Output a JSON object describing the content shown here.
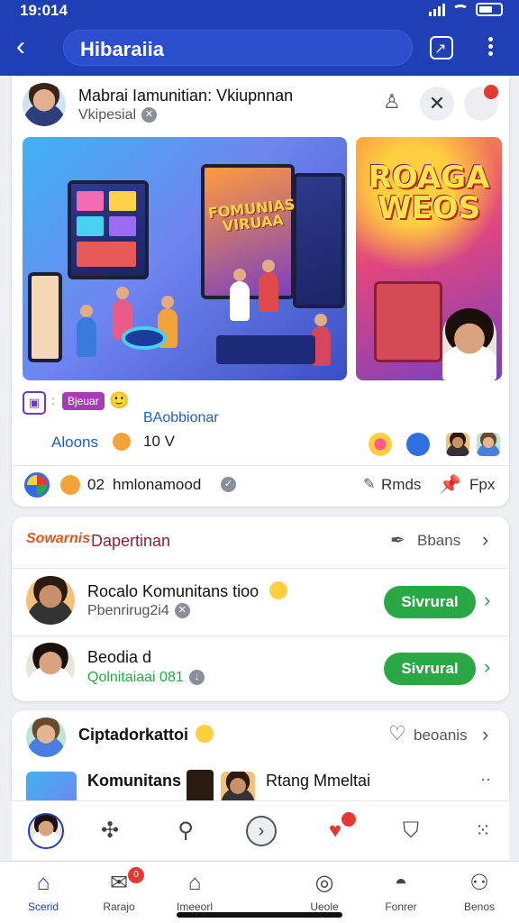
{
  "status_bar": {
    "time": "19:014"
  },
  "header": {
    "title": "Hibaraiia"
  },
  "post": {
    "author": "Mabrai Iamunitian: Vkiupnnan",
    "subline": "Vkipesial",
    "image_main_text": "FOMUNIAS VIRUAA",
    "image_side_text": "ROAGA WEOS",
    "tag": "Bjeuar",
    "link1": "BAobbionar",
    "link2": "Aloons",
    "count": "10 V",
    "footer_num": "02",
    "footer_text": "hmlonamood",
    "action1": "Rmds",
    "action2": "Fpx"
  },
  "section2": {
    "brand": "Sowarnis",
    "title": "Dapertinan",
    "action": "Bbans",
    "rows": [
      {
        "name": "Rocalo Komunitans tioo",
        "sub": "Pbenrirug2i4",
        "button": "Sivrural"
      },
      {
        "name": "Beodia d",
        "sub": "Qolnitaiaai 081",
        "button": "Sivrural"
      }
    ]
  },
  "section3": {
    "title": "Ciptadorkattoi",
    "action": "beoanis",
    "preview1": "Komunitans",
    "preview2": "Rtang Mmeltai"
  },
  "bottom_nav": {
    "items": [
      {
        "label": "Scerid",
        "icon": "home-icon",
        "active": true
      },
      {
        "label": "Rarajo",
        "icon": "message-icon",
        "badge": "0"
      },
      {
        "label": "Imeeorl",
        "icon": "store-icon"
      },
      {
        "label": "Ueole",
        "icon": "chat-icon"
      },
      {
        "label": "Fonrer",
        "icon": "food-icon"
      },
      {
        "label": "Benos",
        "icon": "profile-icon"
      }
    ]
  },
  "colors": {
    "primary": "#1f3fb4",
    "follow_green": "#2aa845",
    "badge_red": "#e53935"
  }
}
